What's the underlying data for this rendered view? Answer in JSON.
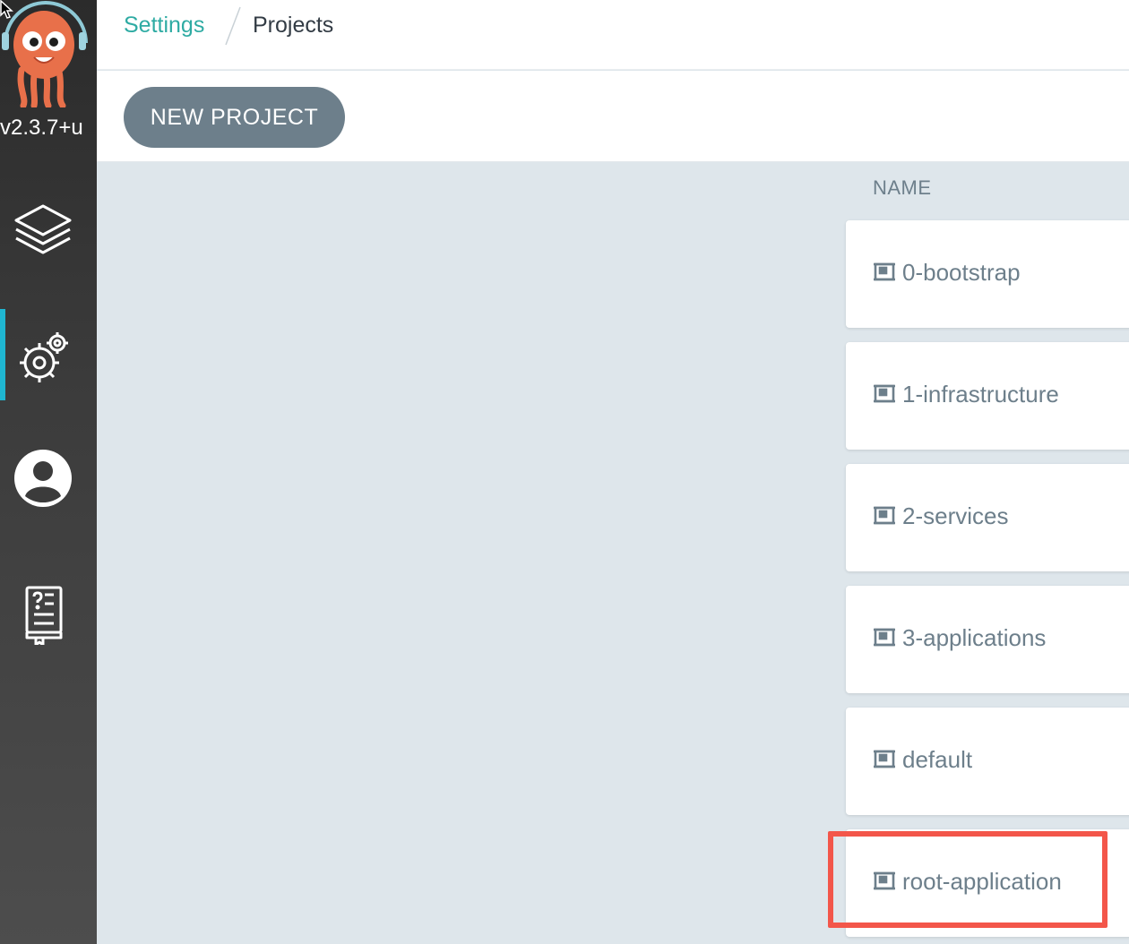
{
  "sidebar": {
    "version": "v2.3.7+u",
    "nav": [
      {
        "icon": "layers-icon",
        "label": "Applications"
      },
      {
        "icon": "gear-icon",
        "label": "Settings",
        "active": true
      },
      {
        "icon": "user-icon",
        "label": "User Info"
      },
      {
        "icon": "docs-icon",
        "label": "Documentation"
      }
    ]
  },
  "breadcrumb": {
    "parent": "Settings",
    "current": "Projects"
  },
  "toolbar": {
    "new_project_label": "NEW PROJECT"
  },
  "table": {
    "column_header": "NAME",
    "rows": [
      {
        "name": "0-bootstrap"
      },
      {
        "name": "1-infrastructure"
      },
      {
        "name": "2-services"
      },
      {
        "name": "3-applications"
      },
      {
        "name": "default"
      },
      {
        "name": "root-application",
        "highlighted": true
      }
    ]
  },
  "colors": {
    "accent": "#1fb6d1",
    "breadcrumb_link": "#2eaba3",
    "button_bg": "#6d7f8b",
    "highlight": "#f3564a",
    "content_bg": "#dee6eb"
  }
}
